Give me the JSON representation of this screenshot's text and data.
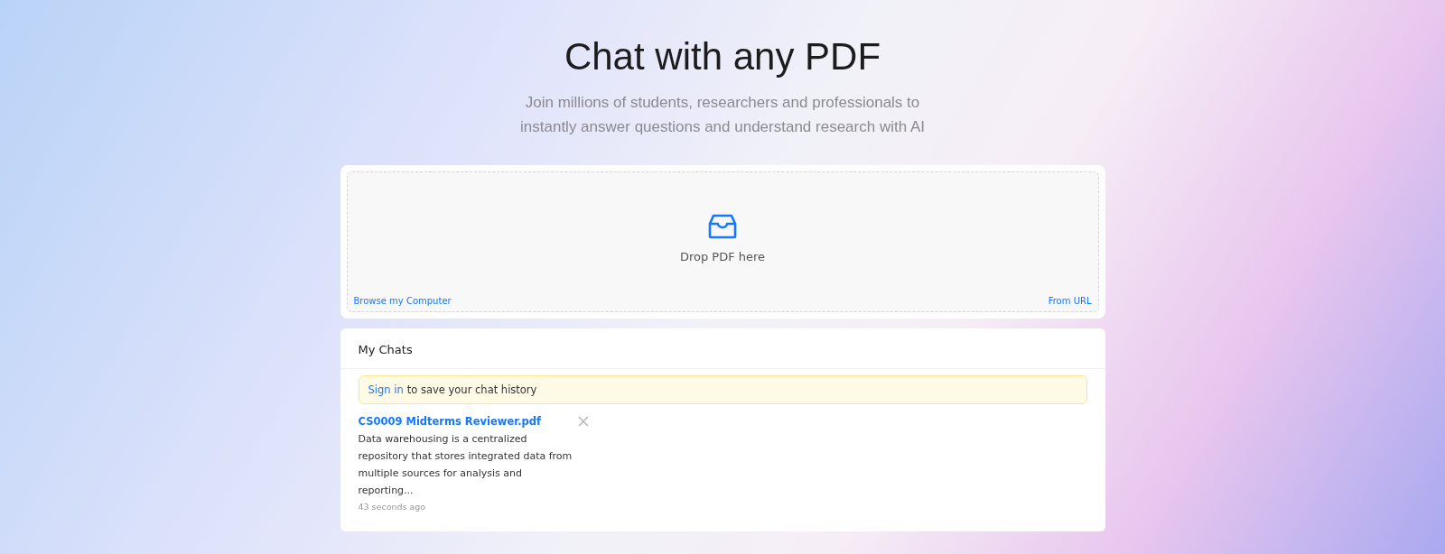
{
  "hero": {
    "title": "Chat with any PDF",
    "subtitle_lines": [
      "Join millions of students, researchers and professionals to",
      "instantly answer questions and understand research with AI"
    ]
  },
  "upload": {
    "prompt": "Drop PDF here",
    "browse_link": "Browse my Computer",
    "url_link": "From URL"
  },
  "chats": {
    "heading": "My Chats",
    "notice": {
      "link": "Sign in",
      "text": "to save your chat history"
    },
    "items": [
      {
        "title": "CS0009 Midterms Reviewer.pdf",
        "summary": "Data warehousing is a centralized repository that stores integrated data from multiple sources for analysis and reporting...",
        "time": "43 seconds ago"
      }
    ]
  }
}
